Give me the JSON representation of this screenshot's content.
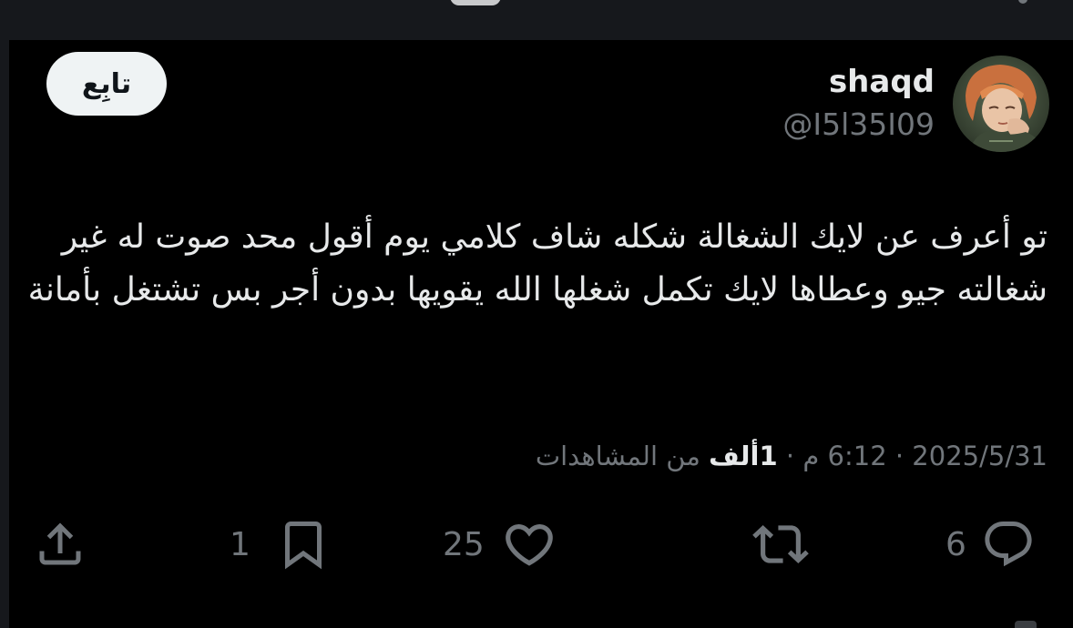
{
  "author": {
    "display_name": "shaqd",
    "handle": "@I5l35I09"
  },
  "follow_button": {
    "label": "تابِع"
  },
  "tweet": {
    "text": "تو أعرف عن لايك الشغالة شكله شاف كلامي يوم أقول محد صوت له غير شغالته جيو وعطاها لايك تكمل شغلها الله يقويها بدون أجر بس تشتغل بأمانة",
    "date": "2025/5/31",
    "time": "6:12 م",
    "views_count": "1ألف",
    "views_label": "من المشاهدات"
  },
  "actions": {
    "replies": "6",
    "retweets": "",
    "likes": "25",
    "bookmarks": "1"
  },
  "icons": {
    "reply": "reply-icon",
    "retweet": "retweet-icon",
    "like": "heart-icon",
    "bookmark": "bookmark-icon",
    "share": "share-icon"
  },
  "colors": {
    "background": "#000000",
    "text_primary": "#e7e9ea",
    "text_secondary": "#71767b",
    "follow_button_bg": "#eff3f4",
    "follow_button_text": "#0f1419"
  }
}
